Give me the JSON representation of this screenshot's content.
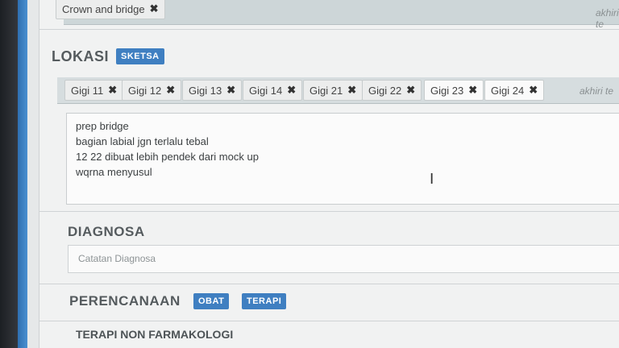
{
  "top": {
    "chip": {
      "label": "Crown and bridge",
      "remove": "✖"
    },
    "ghost": "akhiri te"
  },
  "lokasi": {
    "title": "LOKASI",
    "badge": "SKETSA",
    "chips": [
      {
        "label": "Gigi 11",
        "remove": "✖"
      },
      {
        "label": "Gigi 12",
        "remove": "✖"
      },
      {
        "label": "Gigi 13",
        "remove": "✖"
      },
      {
        "label": "Gigi 14",
        "remove": "✖"
      },
      {
        "label": "Gigi 21",
        "remove": "✖"
      },
      {
        "label": "Gigi 22",
        "remove": "✖"
      },
      {
        "label": "Gigi 23",
        "remove": "✖"
      },
      {
        "label": "Gigi 24",
        "remove": "✖"
      }
    ],
    "ghost": "akhiri te",
    "notes": [
      "prep bridge",
      "bagian labial jgn terlalu tebal",
      "12 22 dibuat lebih pendek dari mock up",
      "wqrna menyusul"
    ]
  },
  "diagnosa": {
    "title": "DIAGNOSA",
    "placeholder": "Catatan Diagnosa"
  },
  "perencanaan": {
    "title": "PERENCANAAN",
    "badges": [
      "OBAT",
      "TERAPI"
    ],
    "subheading": "TERAPI NON FARMAKOLOGI"
  },
  "cursor": "I"
}
